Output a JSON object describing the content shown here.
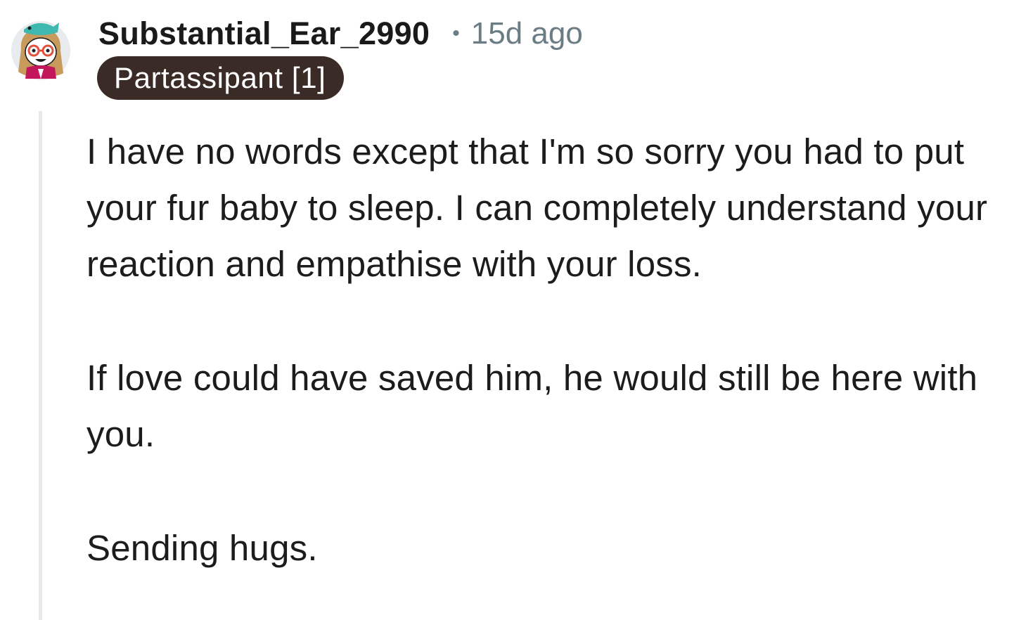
{
  "comment": {
    "author": "Substantial_Ear_2990",
    "separator": "•",
    "timestamp": "15d ago",
    "flair": "Partassipant [1]",
    "avatar_icon": "snoo-avatar-icon",
    "paragraphs": [
      "I have no words except that I'm so sorry you had to put your fur baby to sleep. I can completely understand your reaction and empathise with your loss.",
      "If love could have saved him, he would still be here with you.",
      "Sending hugs."
    ]
  },
  "colors": {
    "flair_background": "#3b2b26",
    "meta_text": "#6b7c85",
    "thread_line": "#e6e8ea"
  }
}
